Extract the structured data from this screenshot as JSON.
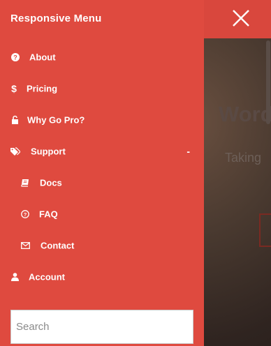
{
  "background": {
    "title": "Word",
    "subtitle": "Taking"
  },
  "menu": {
    "title": "Responsive Menu",
    "items": [
      {
        "label": "About",
        "icon": "question-circle-icon"
      },
      {
        "label": "Pricing",
        "icon": "dollar-icon"
      },
      {
        "label": "Why Go Pro?",
        "icon": "lock-icon"
      },
      {
        "label": "Support",
        "icon": "tags-icon",
        "toggle": "-"
      },
      {
        "label": "Docs",
        "icon": "book-icon"
      },
      {
        "label": "FAQ",
        "icon": "question-circle-outline-icon"
      },
      {
        "label": "Contact",
        "icon": "envelope-icon"
      },
      {
        "label": "Account",
        "icon": "user-icon"
      }
    ],
    "search_placeholder": "Search"
  },
  "colors": {
    "menu_bg": "#df4a3f",
    "topbar_bg": "#d9473d",
    "text": "#ffffff"
  }
}
